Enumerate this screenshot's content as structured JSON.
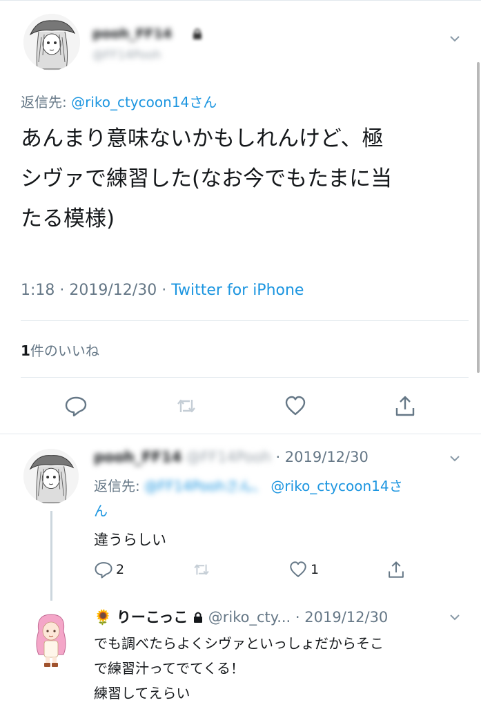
{
  "main_tweet": {
    "display_name": "pooh_FF14",
    "handle": "@FF14Pooh",
    "reply_label": "返信先:",
    "reply_to": "@riko_ctycoon14さん",
    "text_lines": [
      "あんまり意味ないかもしれんけど、極",
      "シヴァで練習した(なお今でもたまに当",
      "たる模様)"
    ],
    "time": "1:18",
    "date": "2019/12/30",
    "source": "Twitter for iPhone",
    "likes_count": "1",
    "likes_label": "件のいいね"
  },
  "reply_tweet": {
    "display_name": "pooh_FF14",
    "handle": "@FF14Pooh",
    "date": "· 2019/12/30",
    "reply_label": "返信先:",
    "reply_to_1": "@FF14Poohさん、",
    "reply_to_2": "@riko_ctycoon14さ",
    "reply_to_wrap": "ん",
    "text": "違うらしい",
    "reply_count": "2",
    "retweet_count": "",
    "like_count": "1"
  },
  "third_tweet": {
    "emoji": "🌻",
    "display_name": "りーこっこ",
    "handle": "@riko_cty...",
    "date": "· 2019/12/30",
    "text_lines": [
      "でも調べたらよくシヴァといっしょだからそこ",
      "で練習汁ってでてくる！",
      "練習してえらい"
    ]
  },
  "icons": {
    "reply": "reply-icon",
    "retweet": "retweet-icon",
    "like": "heart-icon",
    "share": "share-icon",
    "more": "chevron-down-icon",
    "lock": "lock-icon"
  },
  "colors": {
    "link": "#1b95e0",
    "secondary": "#657786",
    "divider": "#e1e8ed",
    "icon": "#657786"
  }
}
